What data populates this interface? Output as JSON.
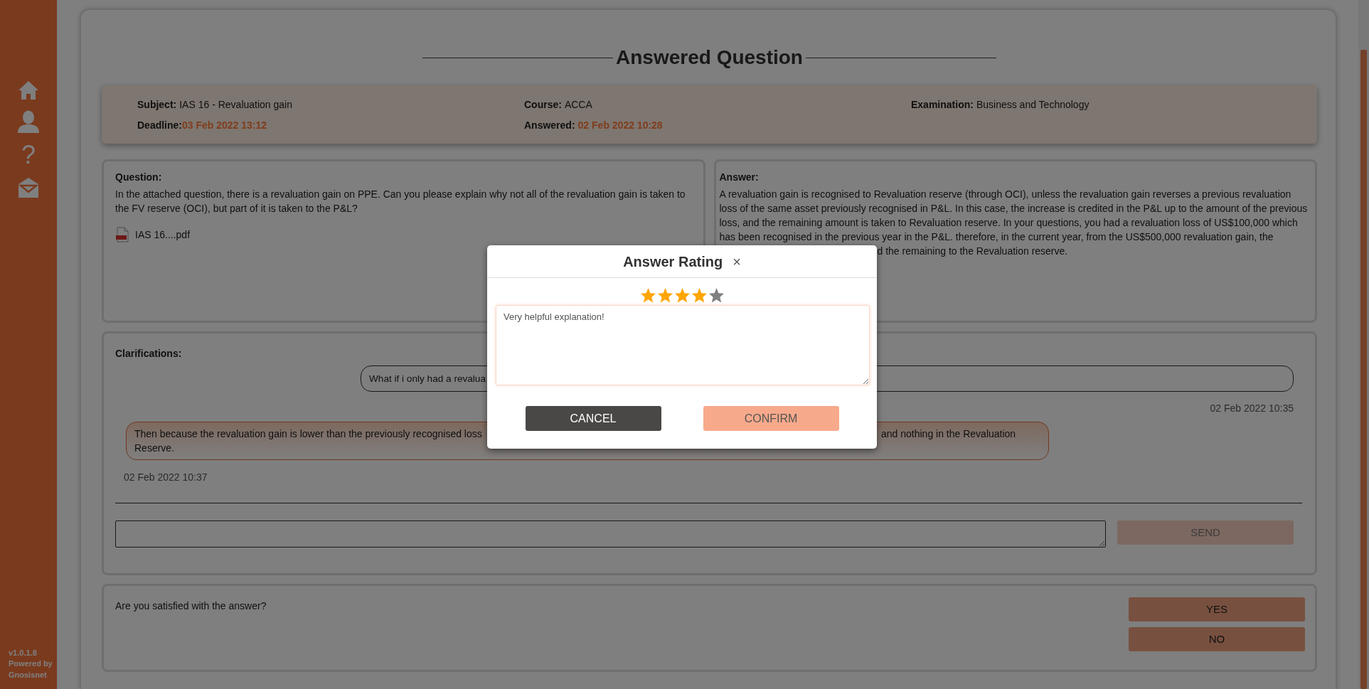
{
  "sidebar": {
    "items": [
      {
        "kind": "home"
      },
      {
        "kind": "user"
      },
      {
        "kind": "help",
        "label": "?"
      },
      {
        "kind": "mail"
      }
    ],
    "footer": [
      "v1.0.1.8",
      "Powered by",
      "Gnosisnet"
    ]
  },
  "page_title": "Answered Question",
  "info": [
    {
      "label": "Subject:",
      "value": "IAS 16 - Revaluation gain",
      "kind": "plain"
    },
    {
      "label": "Course:",
      "value": "ACCA",
      "kind": "plain"
    },
    {
      "label": "Examination:",
      "value": "Business and Technology",
      "kind": "plain"
    },
    {
      "label": "Deadline:",
      "value": "03 Feb 2022 13:12",
      "kind": "date"
    },
    {
      "label": "Answered:",
      "value": "02 Feb 2022 10:28",
      "kind": "date"
    }
  ],
  "question": {
    "heading": "Question:",
    "text": "In the attached question, there is a revaluation gain on PPE. Can you please explain why not all of the revaluation gain is taken to the FV reserve (OCI), but part of it is taken to the P&L?",
    "attachment": "IAS 16....pdf"
  },
  "answer": {
    "heading": "Answer:",
    "text": "A revaluation gain is recognised to Revaluation reserve (through OCI), unless the revaluation gain reverses a previous revaluation loss of the same asset previously recognised in P&L. In this case, the increase is credited in the P&L up to the amount of the previous loss, and the remaining amount is taken to Revaluation reserve. In your questions, you had a revaluation loss of US$100,000 which has been recognised in the previous year in the P&L. therefore, in the current year, from the US$500,000 revaluation gain, the",
    "text_continued": "d the remaining to the Revaluation reserve."
  },
  "clarifications": {
    "heading": "Clarifications:",
    "messages": [
      {
        "kind": "sent",
        "text_start": "What if i only had a revalua",
        "time": "02 Feb 2022 10:35"
      },
      {
        "kind": "received",
        "text_start": "Then because the revaluation gain is lower than the previously recognised loss",
        "text_end": "and nothing in the Revaluation",
        "text_last": "Reserve.",
        "time": "02 Feb 2022 10:37"
      }
    ],
    "send_button": "SEND"
  },
  "satisfaction": {
    "question": "Are you satisfied with the answer?",
    "buttons": [
      "YES",
      "NO"
    ]
  },
  "rating_dialog": {
    "title": "Answer Rating",
    "close": "×",
    "stars": 4,
    "comment": "Very helpful explanation!",
    "buttons": [
      {
        "label": "CANCEL",
        "kind": "secondary"
      },
      {
        "label": "CONFIRM",
        "kind": "primary"
      }
    ]
  }
}
